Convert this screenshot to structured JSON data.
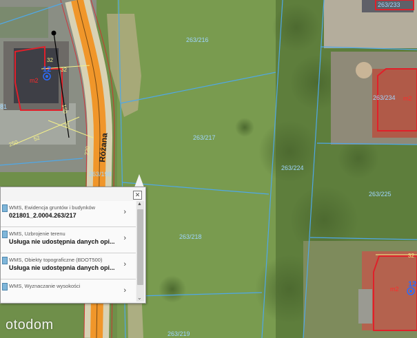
{
  "map": {
    "street_name": "Różana",
    "parcels": [
      "263/216",
      "263/217",
      "263/224",
      "263/218",
      "263/225",
      "263/234",
      "263/233",
      "263/219",
      "263/198",
      "81"
    ],
    "building_tags": [
      "m2",
      "m2",
      "m2"
    ],
    "building_numbers": [
      "12",
      "12"
    ],
    "dimension_labels": [
      "32",
      "32",
      "150",
      "35",
      "250",
      "52",
      "32",
      "220"
    ]
  },
  "popup": {
    "close_icon": "close-icon",
    "items": [
      {
        "name": "WMS, Ewidencja gruntów i budynków",
        "value": "021801_2.0004.263/217"
      },
      {
        "name": "WMS, Uzbrojenie terenu",
        "value": "Usługa nie udostępnia danych opi..."
      },
      {
        "name": "WMS, Obiekty topograficzne (BDOT500)",
        "value": "Usługa nie udostępnia danych opi..."
      },
      {
        "name": "WMS, Wyznaczanie wysokości",
        "value": ""
      }
    ]
  },
  "watermark": {
    "text": "otodom"
  },
  "colors": {
    "parcel_line": "#4fa8e8",
    "building_outline": "#e0202a",
    "road": "#f0962a",
    "grass": "#6f8f4a"
  }
}
